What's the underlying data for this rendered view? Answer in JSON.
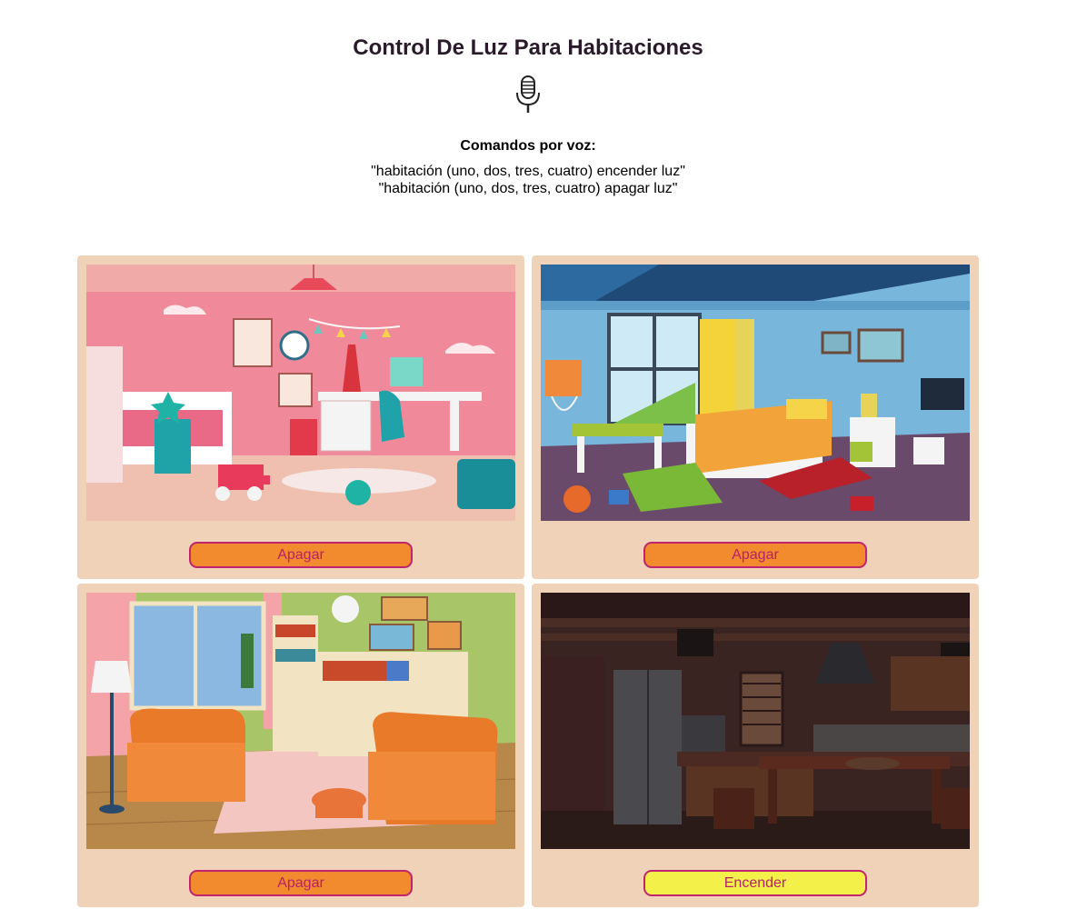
{
  "header": {
    "title": "Control De Luz Para Habitaciones",
    "mic_icon": "microphone-icon"
  },
  "commands": {
    "heading": "Comandos por voz:",
    "lines": [
      "\"habitación (uno, dos, tres, cuatro) encender luz\"",
      "\"habitación (uno, dos, tres, cuatro) apagar luz\""
    ]
  },
  "rooms": [
    {
      "image": "pink-girls-bedroom-illustration",
      "light_on": true,
      "button_label": "Apagar"
    },
    {
      "image": "blue-kids-bedroom-illustration",
      "light_on": true,
      "button_label": "Apagar"
    },
    {
      "image": "living-room-orange-armchairs-illustration",
      "light_on": true,
      "button_label": "Apagar"
    },
    {
      "image": "dark-kitchen-illustration",
      "light_on": false,
      "button_label": "Encender"
    }
  ],
  "colors": {
    "card_background": "#efd2b8",
    "button_on": "#f28a2e",
    "button_off": "#f3f04a",
    "button_border_text": "#c0246e"
  }
}
